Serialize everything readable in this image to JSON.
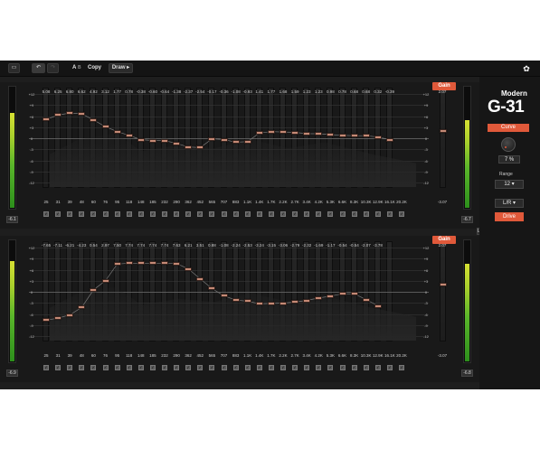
{
  "toolbar": {
    "folder_icon": "folder-icon",
    "undo_icon": "undo-icon",
    "redo_icon": "redo-icon",
    "ab_label": "A",
    "b_label": "B",
    "copy_label": "Copy",
    "draw_label": "Draw ▸",
    "logo_icon": "paw-logo-icon"
  },
  "side": {
    "mode": "Modern",
    "product": "G-31",
    "curve_label": "Curve",
    "curve_value": "7 %",
    "range_label": "Range",
    "range_value": "12 ▾",
    "channel_value": "L/R ▾",
    "drive_label": "Drive"
  },
  "link_badge": "LINK",
  "db_scale": [
    "+12",
    "+9",
    "+6",
    "+3",
    "0",
    "-3",
    "-6",
    "-9",
    "-12"
  ],
  "colors": {
    "accent": "#e0593a",
    "knob": "#c58a76"
  },
  "panels": [
    {
      "gain_label": "Gain",
      "meter_left": "-6.1",
      "meter_right": "-6.7",
      "meter_left_level": 0.78,
      "meter_right_level": 0.72,
      "gains": [
        "5.08",
        "6.25",
        "6.80",
        "6.62",
        "4.92",
        "3.12",
        "1.77",
        "0.78",
        "-0.38",
        "-0.60",
        "-0.64",
        "-1.38",
        "-2.37",
        "-2.54",
        "-0.17",
        "-0.36",
        "-1.08",
        "-0.93",
        "1.41",
        "1.77",
        "1.68",
        "1.59",
        "1.23",
        "1.23",
        "0.98",
        "0.78",
        "0.68",
        "0.68",
        "0.32",
        "-0.39"
      ],
      "out_gain": "2.07",
      "out_value": "-3.07",
      "freqs": [
        "25",
        "31",
        "39",
        "48",
        "60",
        "76",
        "95",
        "118",
        "148",
        "185",
        "232",
        "290",
        "362",
        "452",
        "565",
        "707",
        "883",
        "1.1K",
        "1.4K",
        "1.7K",
        "2.2K",
        "2.7K",
        "3.4K",
        "4.2K",
        "5.3K",
        "6.6K",
        "8.3K",
        "10.3K",
        "12.9K",
        "16.1K",
        "20.2K"
      ]
    },
    {
      "gain_label": "Gain",
      "meter_left": "-6.9",
      "meter_right": "-6.8",
      "meter_left_level": 0.82,
      "meter_right_level": 0.8,
      "gains": [
        "-7.65",
        "-7.11",
        "-6.21",
        "-4.23",
        "0.54",
        "2.97",
        "7.50",
        "7.74",
        "7.74",
        "7.74",
        "7.74",
        "7.63",
        "6.21",
        "3.51",
        "0.88",
        "-1.08",
        "-2.24",
        "-2.53",
        "-3.24",
        "-3.15",
        "-3.06",
        "-2.79",
        "-2.32",
        "-1.69",
        "-1.17",
        "-0.54",
        "-0.54",
        "-2.07",
        "-3.78"
      ],
      "out_gain": "2.07",
      "out_value": "-3.07",
      "freqs": [
        "25",
        "31",
        "39",
        "48",
        "60",
        "76",
        "95",
        "118",
        "148",
        "185",
        "232",
        "290",
        "362",
        "452",
        "565",
        "707",
        "883",
        "1.1K",
        "1.4K",
        "1.7K",
        "2.2K",
        "2.7K",
        "3.4K",
        "4.2K",
        "5.3K",
        "6.6K",
        "8.3K",
        "10.3K",
        "12.9K",
        "16.1K",
        "20.2K"
      ]
    }
  ]
}
